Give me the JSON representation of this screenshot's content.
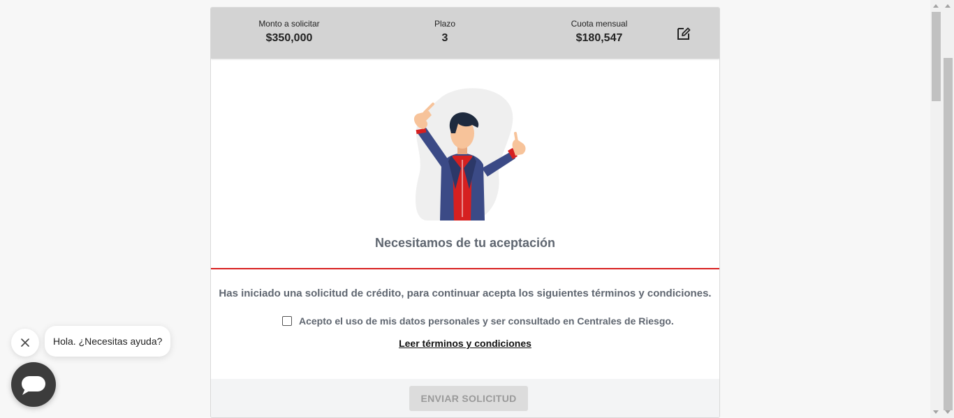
{
  "summary": {
    "monto_label": "Monto a solicitar",
    "monto_value": "$350,000",
    "plazo_label": "Plazo",
    "plazo_value": "3",
    "cuota_label": "Cuota mensual",
    "cuota_value": "$180,547",
    "edit_icon": "edit-icon"
  },
  "main": {
    "heading": "Necesitamos de tu aceptación",
    "intro": "Has iniciado una solicitud de crédito, para continuar acepta los siguientes términos y condiciones.",
    "consent_label": "Acepto el uso de mis datos personales y ser consultado en Centrales de Riesgo.",
    "consent_checked": false,
    "terms_link": "Leer términos y condiciones",
    "submit_label": "ENVIAR SOLICITUD",
    "submit_enabled": false
  },
  "chat": {
    "greeting": "Hola. ¿Necesitas ayuda?",
    "close_icon": "close-icon",
    "launcher_icon": "chat-icon"
  },
  "colors": {
    "accent_red": "#d81e1e",
    "summary_bg": "#d3d3d3",
    "text_gray": "#5f6670",
    "chat_dark": "#3c3c3c"
  }
}
